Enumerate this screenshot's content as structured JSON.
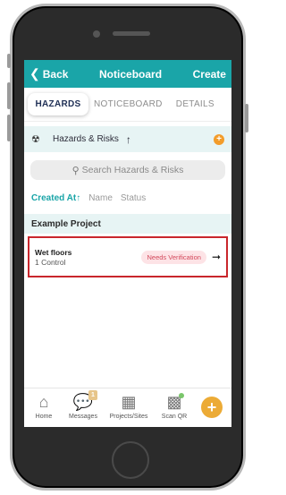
{
  "navbar": {
    "back_label": "Back",
    "title": "Noticeboard",
    "create_label": "Create"
  },
  "tabs": [
    {
      "label": "HAZARDS",
      "active": true
    },
    {
      "label": "NOTICEBOARD",
      "active": false
    },
    {
      "label": "DETAILS",
      "active": false
    }
  ],
  "section": {
    "title": "Hazards & Risks",
    "sort_arrow": "↑",
    "add": "+"
  },
  "search": {
    "placeholder": "Search Hazards & Risks"
  },
  "sort": {
    "created_at": "Created At",
    "arrow": "↑",
    "name": "Name",
    "status": "Status"
  },
  "project": {
    "name": "Example Project"
  },
  "hazards": [
    {
      "name": "Wet floors",
      "controls": "1 Control",
      "status": "Needs Verification"
    }
  ],
  "bottom_nav": {
    "items": [
      {
        "label": "Home",
        "icon": "home-icon"
      },
      {
        "label": "Messages",
        "icon": "chat-bubbles-icon",
        "badge": "1"
      },
      {
        "label": "Projects/Sites",
        "icon": "building-icon"
      },
      {
        "label": "Scan QR",
        "icon": "qr-code-icon"
      }
    ],
    "fab": "+"
  },
  "colors": {
    "accent": "#1aa5a8",
    "badge_bg": "#fde3e6",
    "badge_text": "#d3485b",
    "fab": "#ecab36",
    "highlight": "#c9262c"
  }
}
